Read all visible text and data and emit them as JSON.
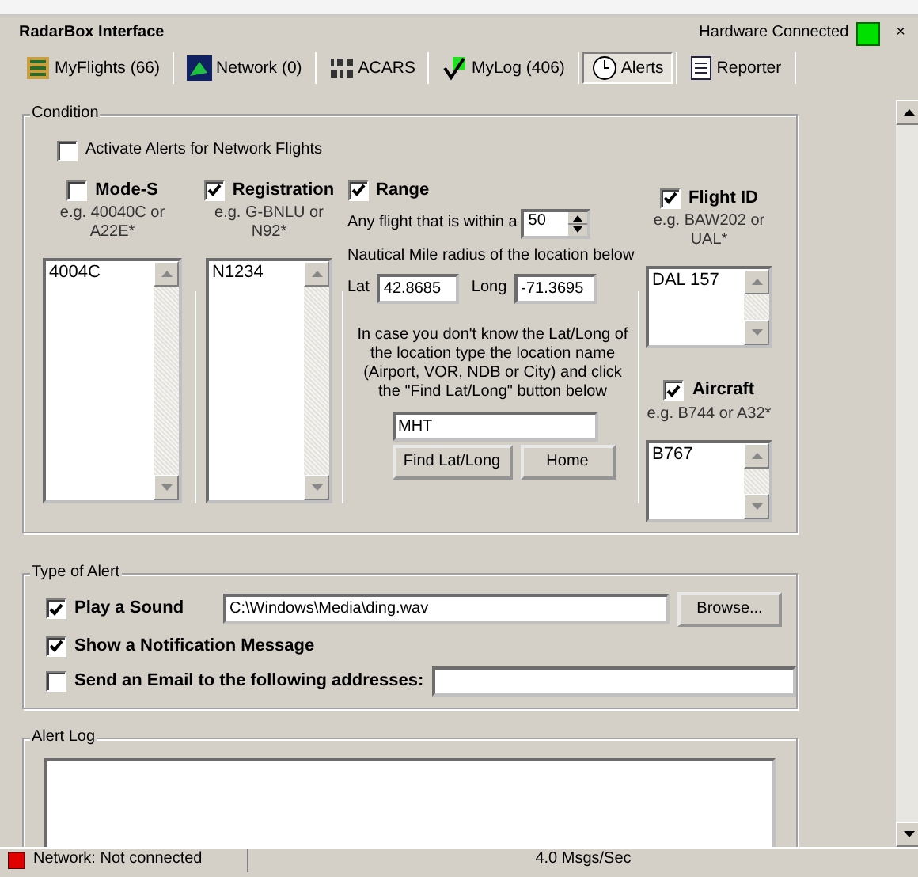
{
  "window": {
    "title": "RadarBox Interface",
    "hardware": {
      "label": "Hardware Connected",
      "color": "#00e000"
    },
    "close": "×"
  },
  "tabs": [
    {
      "label": "MyFlights (66)",
      "selected": false
    },
    {
      "label": "Network (0)",
      "selected": false
    },
    {
      "label": "ACARS",
      "selected": false
    },
    {
      "label": "MyLog (406)",
      "selected": false
    },
    {
      "label": "Alerts",
      "selected": true
    },
    {
      "label": "Reporter",
      "selected": false
    }
  ],
  "condition": {
    "legend": "Condition",
    "network_alerts": {
      "label": "Activate Alerts for Network Flights",
      "checked": false
    },
    "mode_s": {
      "label": "Mode-S",
      "checked": false,
      "hint": "e.g. 40040C or A22E*",
      "items": [
        "4004C"
      ]
    },
    "registration": {
      "label": "Registration",
      "checked": true,
      "hint": "e.g. G-BNLU or N92*",
      "items": [
        "N1234"
      ]
    },
    "range": {
      "label": "Range",
      "checked": true,
      "within_text": "Any flight that is within a",
      "radius": "50",
      "radius_text": "Nautical Mile radius of the location below",
      "lat_label": "Lat",
      "lat": "42.8685",
      "long_label": "Long",
      "long": "-71.3695",
      "help": "In case you don't know the Lat/Long of the location type the location name (Airport, VOR, NDB or City) and click the \"Find Lat/Long\" button below",
      "location": "MHT",
      "buttons": [
        "Find Lat/Long",
        "Home"
      ]
    },
    "flight_id": {
      "label": "Flight ID",
      "checked": true,
      "hint": "e.g. BAW202 or UAL*",
      "items": [
        "DAL 157"
      ]
    },
    "aircraft": {
      "label": "Aircraft",
      "checked": true,
      "hint": "e.g. B744 or A32*",
      "items": [
        "B767"
      ]
    }
  },
  "type_of_alert": {
    "legend": "Type of Alert",
    "play_sound": {
      "label": "Play a Sound",
      "checked": true,
      "path": "C:\\Windows\\Media\\ding.wav",
      "button": "Browse..."
    },
    "notification": {
      "label": "Show a Notification Message",
      "checked": true
    },
    "email": {
      "label": "Send an Email to the following addresses:",
      "checked": false
    }
  },
  "alert_log": {
    "legend": "Alert Log"
  },
  "status_bar": {
    "network": {
      "label": "Network: Not connected",
      "color": "#e00000"
    },
    "rate": "4.0 Msgs/Sec"
  }
}
